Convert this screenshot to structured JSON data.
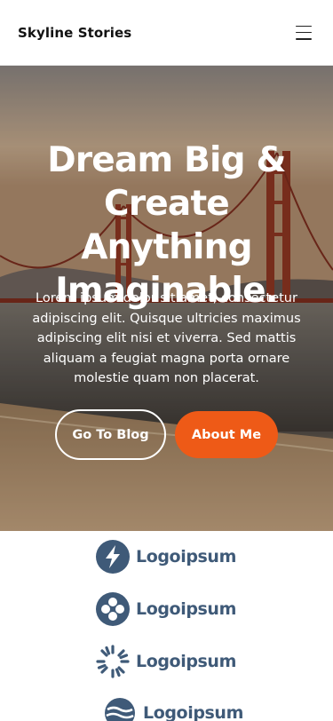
{
  "header": {
    "brand": "Skyline Stories",
    "menu_icon": "hamburger-menu-icon"
  },
  "hero": {
    "title": "Dream Big & Create Anything Imaginable.",
    "text": "Lorem ipsum dolor sit amet, consectetur adipiscing elit. Quisque ultricies maximus adipiscing elit nisi et viverra. Sed mattis aliquam a feugiat magna porta ornare molestie quam non placerat.",
    "primary_button": "Go To Blog",
    "secondary_button": "About Me",
    "accent_color": "#ee5a17",
    "background": "golden-gate-bridge-photo"
  },
  "logos": [
    {
      "icon": "lightning-bolt-icon",
      "text": "Logoipsum"
    },
    {
      "icon": "four-circles-icon",
      "text": "Logoipsum"
    },
    {
      "icon": "sunburst-icon",
      "text": "Logoipsum"
    },
    {
      "icon": "wave-circle-icon",
      "text": "Logoipsum"
    }
  ],
  "colors": {
    "logo_color": "#3f5a78",
    "header_background": "#ffffff"
  }
}
